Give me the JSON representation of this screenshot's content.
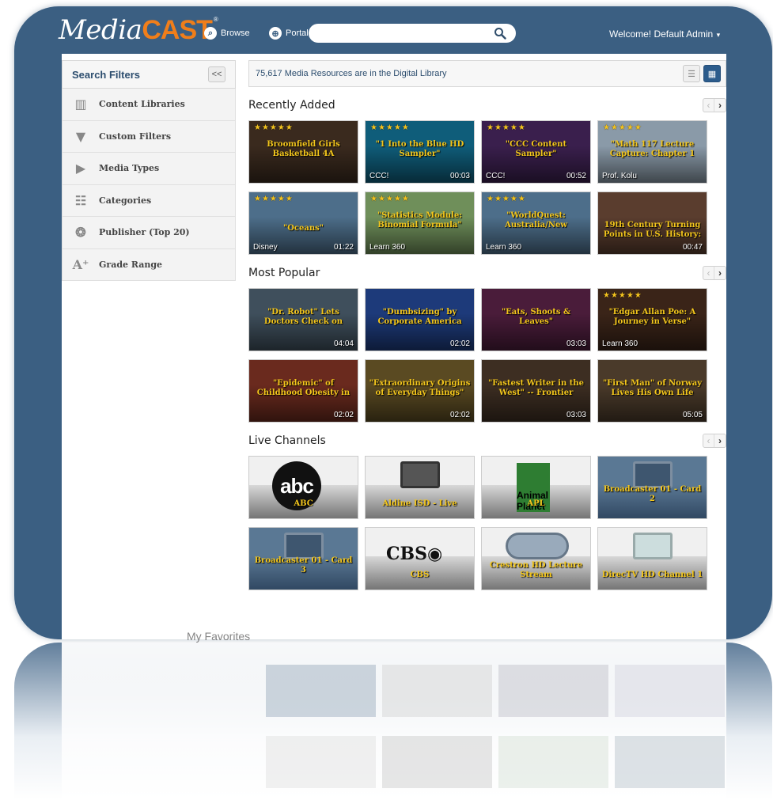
{
  "header": {
    "logo_media": "Media",
    "logo_cast": "CAST",
    "logo_tm": "®",
    "browse_label": "Browse",
    "portal_label": "Portal",
    "search_placeholder": "",
    "welcome": "Welcome! Default Admin"
  },
  "sidebar": {
    "title": "Search Filters",
    "collapse_label": "<<",
    "items": [
      {
        "label": "Content Libraries",
        "icon": "books-icon"
      },
      {
        "label": "Custom Filters",
        "icon": "funnel-icon"
      },
      {
        "label": "Media Types",
        "icon": "media-play-icon"
      },
      {
        "label": "Categories",
        "icon": "tree-icon"
      },
      {
        "label": "Publisher (Top 20)",
        "icon": "publisher-icon"
      },
      {
        "label": "Grade Range",
        "icon": "grade-icon"
      }
    ]
  },
  "main": {
    "resource_count": "75,617 Media Resources are in the Digital Library",
    "sections": {
      "recent": {
        "title": "Recently Added",
        "tiles": [
          {
            "title": "Broomfield Girls Basketball 4A",
            "stars": "★★★★★",
            "publisher": "",
            "duration": ""
          },
          {
            "title": "\"1 Into the Blue HD Sampler\"",
            "stars": "★★★★★",
            "publisher": "CCC!",
            "duration": "00:03"
          },
          {
            "title": "\"CCC Content Sampler\"",
            "stars": "★★★★★",
            "publisher": "CCC!",
            "duration": "00:52"
          },
          {
            "title": "\"Math 117 Lecture Capture: Chapter 1",
            "stars": "★★★★★",
            "publisher": "Prof. Kolu",
            "duration": ""
          },
          {
            "title": "\"Oceans\"",
            "stars": "★★★★★",
            "publisher": "Disney",
            "duration": "01:22"
          },
          {
            "title": "\"Statistics Module: Binomial Formula\"",
            "stars": "★★★★★",
            "publisher": "Learn 360",
            "duration": ""
          },
          {
            "title": "\"WorldQuest: Australia/New",
            "stars": "★★★★★",
            "publisher": "Learn 360",
            "duration": ""
          },
          {
            "title": "19th Century Turning Points in U.S. History:",
            "stars": "",
            "publisher": "",
            "duration": "00:47"
          }
        ]
      },
      "popular": {
        "title": "Most Popular",
        "tiles": [
          {
            "title": "\"Dr. Robot\" Lets Doctors Check on",
            "stars": "",
            "publisher": "",
            "duration": "04:04"
          },
          {
            "title": "\"Dumbsizing\" by Corporate America",
            "stars": "",
            "publisher": "",
            "duration": "02:02"
          },
          {
            "title": "\"Eats, Shoots & Leaves\"",
            "stars": "",
            "publisher": "",
            "duration": "03:03"
          },
          {
            "title": "\"Edgar Allan Poe: A Journey in Verse\"",
            "stars": "★★★★★",
            "publisher": "Learn 360",
            "duration": ""
          },
          {
            "title": "\"Epidemic\" of Childhood Obesity in",
            "stars": "",
            "publisher": "",
            "duration": "02:02"
          },
          {
            "title": "\"Extraordinary Origins of Everyday Things\"",
            "stars": "",
            "publisher": "",
            "duration": "02:02"
          },
          {
            "title": "\"Fastest Writer in the West\" -- Frontier",
            "stars": "",
            "publisher": "",
            "duration": "03:03"
          },
          {
            "title": "\"First Man\" of Norway Lives His Own Life",
            "stars": "",
            "publisher": "",
            "duration": "05:05"
          }
        ]
      },
      "live": {
        "title": "Live Channels",
        "tiles": [
          {
            "title": "ABC",
            "logo": "abc"
          },
          {
            "title": "Aldine ISD - Live",
            "logo": "camera"
          },
          {
            "title": "APL",
            "logo": "apl"
          },
          {
            "title": "Broadcaster 01 - Card 2",
            "logo": "film"
          },
          {
            "title": "Broadcaster 01 - Card 3",
            "logo": "film"
          },
          {
            "title": "CBS",
            "logo": "cbs"
          },
          {
            "title": "Crestron HD Lecture Stream",
            "logo": "people"
          },
          {
            "title": "DirecTV HD Channel 1",
            "logo": "satellite"
          }
        ]
      },
      "favorites": {
        "title": "My Favorites"
      }
    },
    "logo_text": {
      "abc": "abc",
      "cbs": "CBS◉",
      "apl": "Animal Planet"
    }
  },
  "colors": {
    "frame": "#3b5f82",
    "brand_orange": "#f07e1a",
    "tile_title": "#f3c61c",
    "star": "#f4c41f",
    "view_active": "#2c5c8c"
  }
}
